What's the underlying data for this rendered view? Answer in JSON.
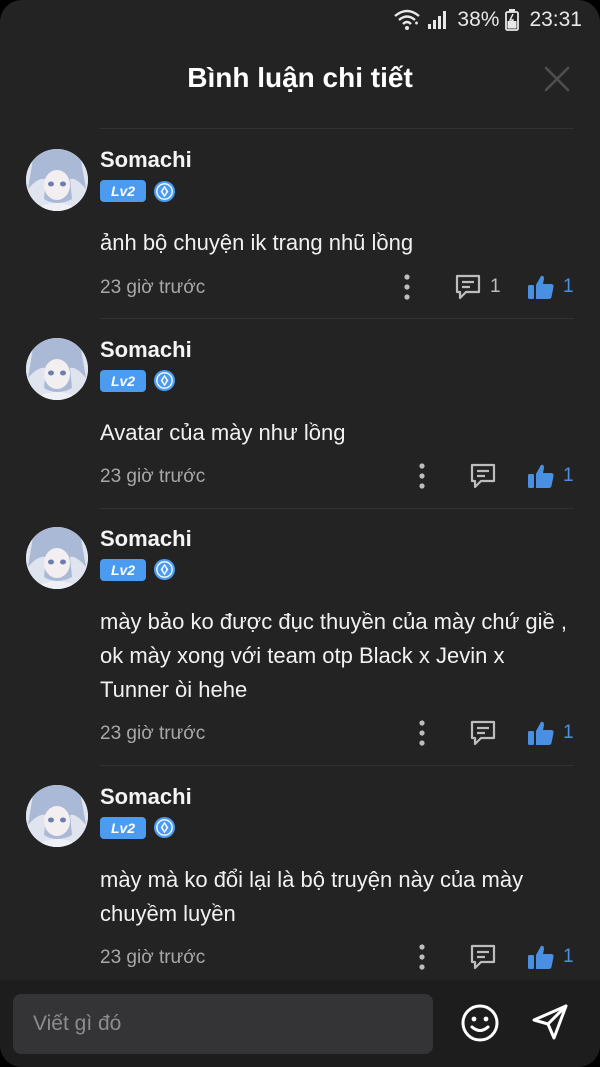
{
  "status_bar": {
    "battery_percent": "38%",
    "time": "23:31",
    "icons": [
      "wifi-icon",
      "signal-icon",
      "battery-icon"
    ]
  },
  "header": {
    "title": "Bình luận chi tiết",
    "close_icon": "close-icon"
  },
  "comments": [
    {
      "username": "Somachi",
      "level": "Lv2",
      "text": "ảnh bộ chuyện ik trang nhũ lồng",
      "time": "23 giờ trước",
      "reply_count": "1",
      "like_count": "1"
    },
    {
      "username": "Somachi",
      "level": "Lv2",
      "text": "Avatar của mày như lồng",
      "time": "23 giờ trước",
      "reply_count": "",
      "like_count": "1"
    },
    {
      "username": "Somachi",
      "level": "Lv2",
      "text": "mày bảo ko được đục thuyền của mày chứ giề , ok mày xong với team otp Black x Jevin x Tunner òi hehe",
      "time": "23 giờ trước",
      "reply_count": "",
      "like_count": "1"
    },
    {
      "username": "Somachi",
      "level": "Lv2",
      "text": "mày mà ko đổi lại là bộ truyện này của mày chuyềm luyền",
      "time": "23 giờ trước",
      "reply_count": "",
      "like_count": "1"
    }
  ],
  "composer": {
    "placeholder": "Viết gì đó",
    "value": ""
  },
  "colors": {
    "background": "#232324",
    "accent": "#4a90e2",
    "badge": "#4b9bf0",
    "muted_text": "#a8a8a8"
  }
}
